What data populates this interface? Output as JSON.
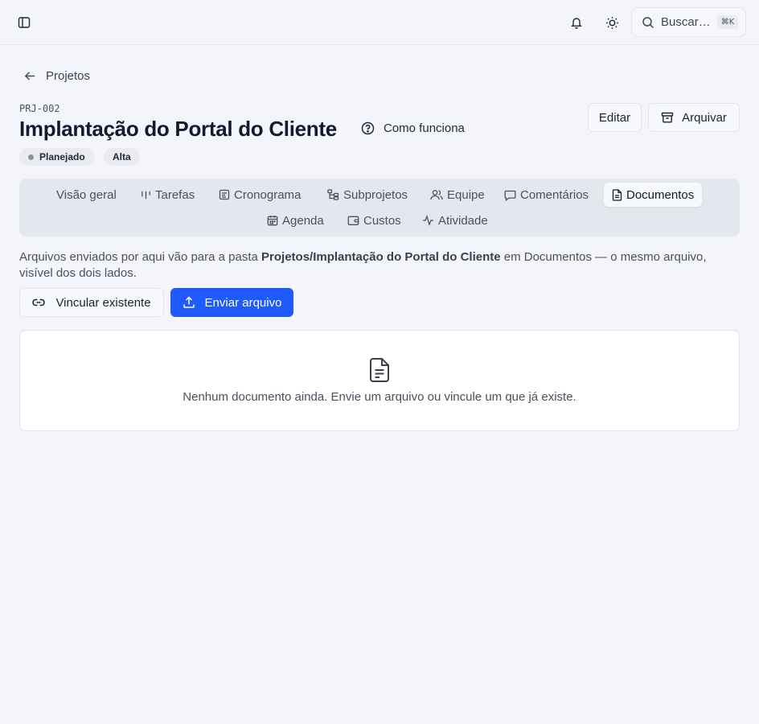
{
  "topbar": {
    "search_placeholder": "Buscar…",
    "shortcut": "⌘K"
  },
  "breadcrumb": {
    "back_label": "Projetos"
  },
  "project": {
    "code": "PRJ-002",
    "title": "Implantação do Portal do Cliente",
    "how_label": "Como funciona",
    "status": "Planejado",
    "priority": "Alta"
  },
  "actions": {
    "edit_label": "Editar",
    "archive_label": "Arquivar"
  },
  "tabs": [
    {
      "label": "Visão geral",
      "icon": "none"
    },
    {
      "label": "Tarefas",
      "icon": "kanban-icon"
    },
    {
      "label": "Cronograma",
      "icon": "timeline-icon"
    },
    {
      "label": "Subprojetos",
      "icon": "subprojects-icon"
    },
    {
      "label": "Equipe",
      "icon": "users-icon"
    },
    {
      "label": "Comentários",
      "icon": "comment-icon"
    },
    {
      "label": "Documentos",
      "icon": "document-icon",
      "active": true
    },
    {
      "label": "Agenda",
      "icon": "calendar-icon"
    },
    {
      "label": "Custos",
      "icon": "wallet-icon"
    },
    {
      "label": "Atividade",
      "icon": "activity-icon"
    }
  ],
  "documents": {
    "desc_before": "Arquivos enviados por aqui vão para a pasta ",
    "desc_folder": "Projetos/Implantação do Portal do Cliente",
    "desc_after": " em Documentos — o mesmo arquivo, visível dos dois lados.",
    "link_label": "Vincular existente",
    "upload_label": "Enviar arquivo",
    "empty_text": "Nenhum documento ainda. Envie um arquivo ou vincule um que já existe."
  },
  "colors": {
    "accent": "#1f5bfa",
    "background": "#f4f5fb"
  }
}
